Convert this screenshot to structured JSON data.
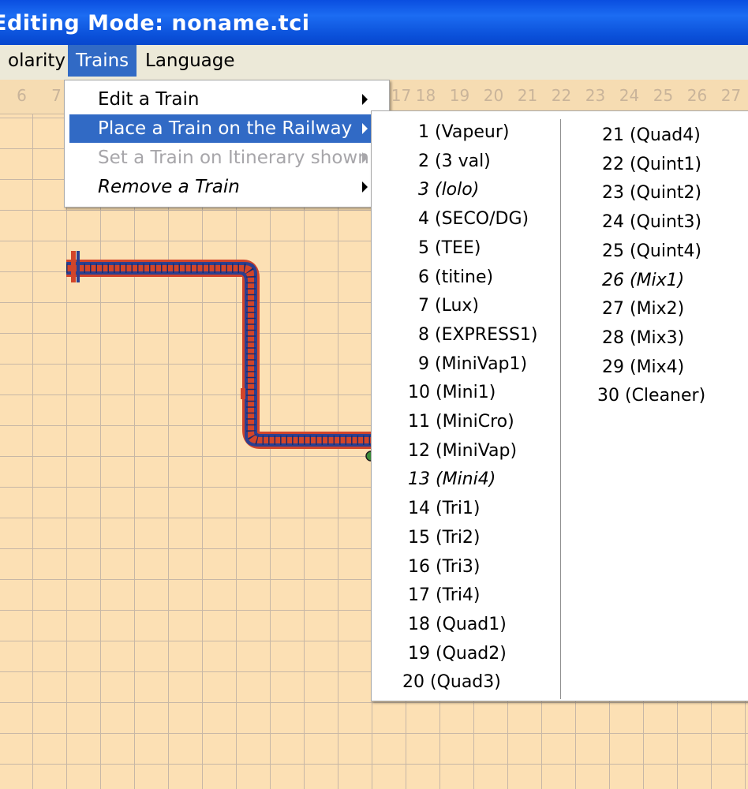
{
  "window": {
    "title": "Editing Mode: noname.tci"
  },
  "menubar": {
    "items": [
      {
        "label": "olarity"
      },
      {
        "label": "Trains",
        "active": true
      },
      {
        "label": "Language"
      }
    ]
  },
  "ruler": {
    "left_numbers": [
      "6",
      "7"
    ],
    "right_numbers": [
      "17",
      "18",
      "19",
      "20",
      "21",
      "22",
      "23",
      "24",
      "25",
      "26",
      "27"
    ]
  },
  "trains_menu": {
    "items": [
      {
        "label": "Edit a Train",
        "has_submenu": true
      },
      {
        "label": "Place a Train on the Railway",
        "has_submenu": true,
        "highlighted": true
      },
      {
        "label": "Set a Train on Itinerary shown",
        "has_submenu": true,
        "disabled": true
      },
      {
        "label": "Remove a Train",
        "has_submenu": true,
        "italic": true
      }
    ]
  },
  "train_submenu": {
    "column1": [
      {
        "label": "1 (Vapeur)"
      },
      {
        "label": "2 (3 val)"
      },
      {
        "label": "3 (lolo)",
        "italic": true
      },
      {
        "label": "4 (SECO/DG)"
      },
      {
        "label": "5 (TEE)"
      },
      {
        "label": "6 (titine)"
      },
      {
        "label": "7 (Lux)"
      },
      {
        "label": "8 (EXPRESS1)"
      },
      {
        "label": "9 (MiniVap1)"
      },
      {
        "label": "10 (Mini1)"
      },
      {
        "label": "11 (MiniCro)"
      },
      {
        "label": "12 (MiniVap)"
      },
      {
        "label": "13 (Mini4)",
        "italic": true
      },
      {
        "label": "14 (Tri1)"
      },
      {
        "label": "15 (Tri2)"
      },
      {
        "label": "16 (Tri3)"
      },
      {
        "label": "17 (Tri4)"
      },
      {
        "label": "18 (Quad1)"
      },
      {
        "label": "19 (Quad2)"
      },
      {
        "label": "20 (Quad3)"
      }
    ],
    "column2": [
      {
        "label": "21 (Quad4)"
      },
      {
        "label": "22 (Quint1)"
      },
      {
        "label": "23 (Quint2)"
      },
      {
        "label": "24 (Quint3)"
      },
      {
        "label": "25 (Quint4)"
      },
      {
        "label": "26 (Mix1)",
        "italic": true
      },
      {
        "label": "27 (Mix2)"
      },
      {
        "label": "28 (Mix3)"
      },
      {
        "label": "29 (Mix4)"
      },
      {
        "label": "30 (Cleaner)"
      }
    ]
  },
  "colors": {
    "titlebar": "#0a4ee0",
    "menubar": "#ece9d8",
    "grid_background": "#fce0b4",
    "grid_lines": "#c7b7a6",
    "highlight": "#316ac5",
    "track_outer": "#d2452a",
    "track_rails": "#2c3f8f"
  }
}
